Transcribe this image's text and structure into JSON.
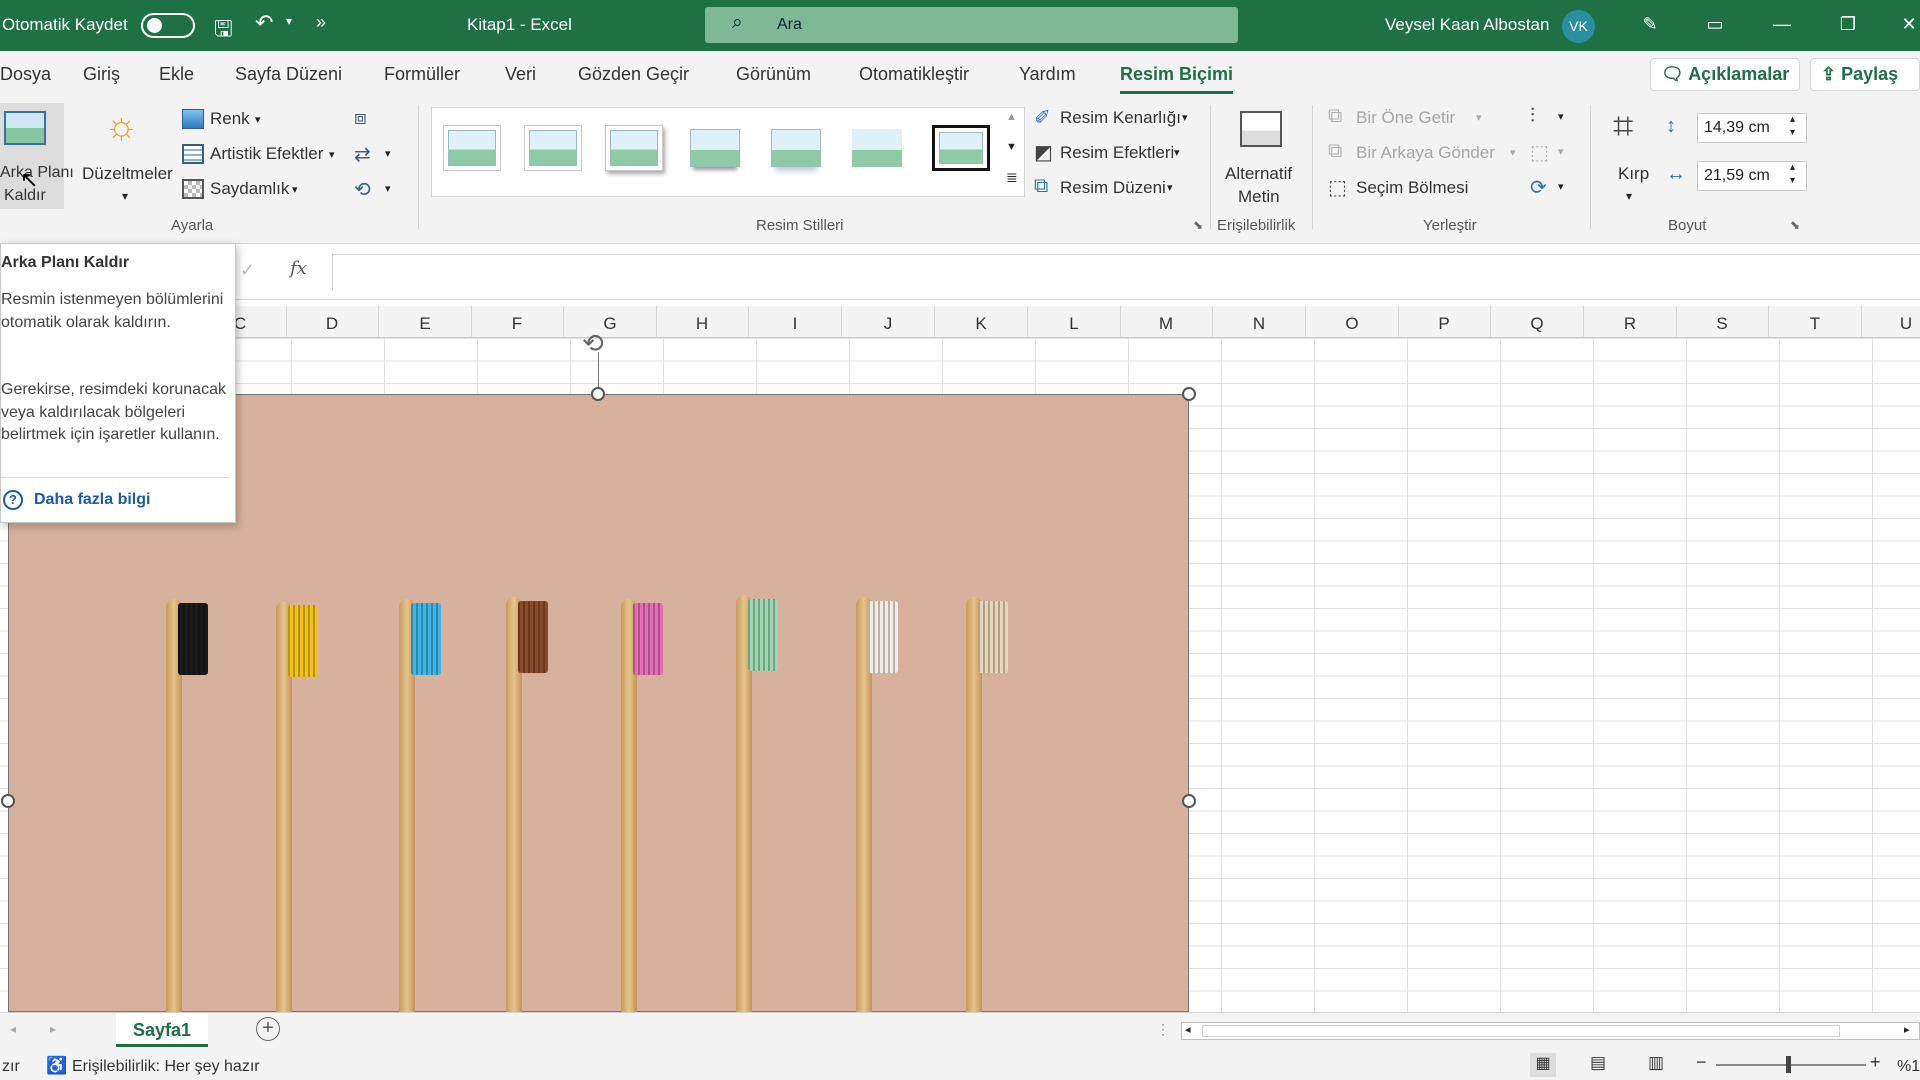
{
  "titlebar": {
    "autosave_label": "Otomatik Kaydet",
    "doc_title": "Kitap1 - Excel",
    "search_placeholder": "Ara",
    "user_name": "Veysel Kaan Albostan",
    "user_initials": "VK",
    "colors": {
      "bar": "#1f7145",
      "accent": "#1d7044"
    }
  },
  "tabs": [
    "Dosya",
    "Giriş",
    "Ekle",
    "Sayfa Düzeni",
    "Formüller",
    "Veri",
    "Gözden Geçir",
    "Görünüm",
    "Otomatikleştir",
    "Yardım",
    "Resim Biçimi"
  ],
  "active_tab": "Resim Biçimi",
  "ribbon_right": {
    "comments": "Açıklamalar",
    "share": "Paylaş"
  },
  "ribbon": {
    "remove_bg_line1": "Arka Planı",
    "remove_bg_line2": "Kaldır",
    "corrections": "Düzeltmeler",
    "color": "Renk",
    "artistic": "Artistik Efektler",
    "transparency": "Saydamlık",
    "group_adjust": "Ayarla",
    "group_styles": "Resim Stilleri",
    "border": "Resim Kenarlığı",
    "effects": "Resim Efektleri",
    "layout": "Resim Düzeni",
    "alt_text_line1": "Alternatif",
    "alt_text_line2": "Metin",
    "group_access": "Erişilebilirlik",
    "bring_forward": "Bir Öne Getir",
    "send_backward": "Bir Arkaya Gönder",
    "selection_pane": "Seçim Bölmesi",
    "group_arrange": "Yerleştir",
    "crop": "Kırp",
    "height": "14,39 cm",
    "width": "21,59 cm",
    "group_size": "Boyut"
  },
  "formula_bar": {
    "fx": "fx"
  },
  "columns": [
    "C",
    "D",
    "E",
    "F",
    "G",
    "H",
    "I",
    "J",
    "K",
    "L",
    "M",
    "N",
    "O",
    "P",
    "Q",
    "R",
    "S",
    "T",
    "U"
  ],
  "tooltip": {
    "title": "Arka Planı Kaldır",
    "para1": "Resmin istenmeyen bölümlerini otomatik olarak kaldırın.",
    "para2": "Gerekirse, resimdeki korunacak veya kaldırılacak bölgeleri belirtmek için işaretler kullanın.",
    "link": "Daha fazla bilgi"
  },
  "picture": {
    "bristle_colors": [
      "#1b1b1b",
      "#f2c21b",
      "#3fb4e6",
      "#8a4a2c",
      "#e46fb7",
      "#9ed8b3",
      "#f3ece4",
      "#e8d6b8"
    ]
  },
  "sheet": {
    "tab": "Sayfa1"
  },
  "status": {
    "ready": "zır",
    "accessibility": "Erişilebilirlik: Her şey hazır",
    "zoom": "%1"
  }
}
